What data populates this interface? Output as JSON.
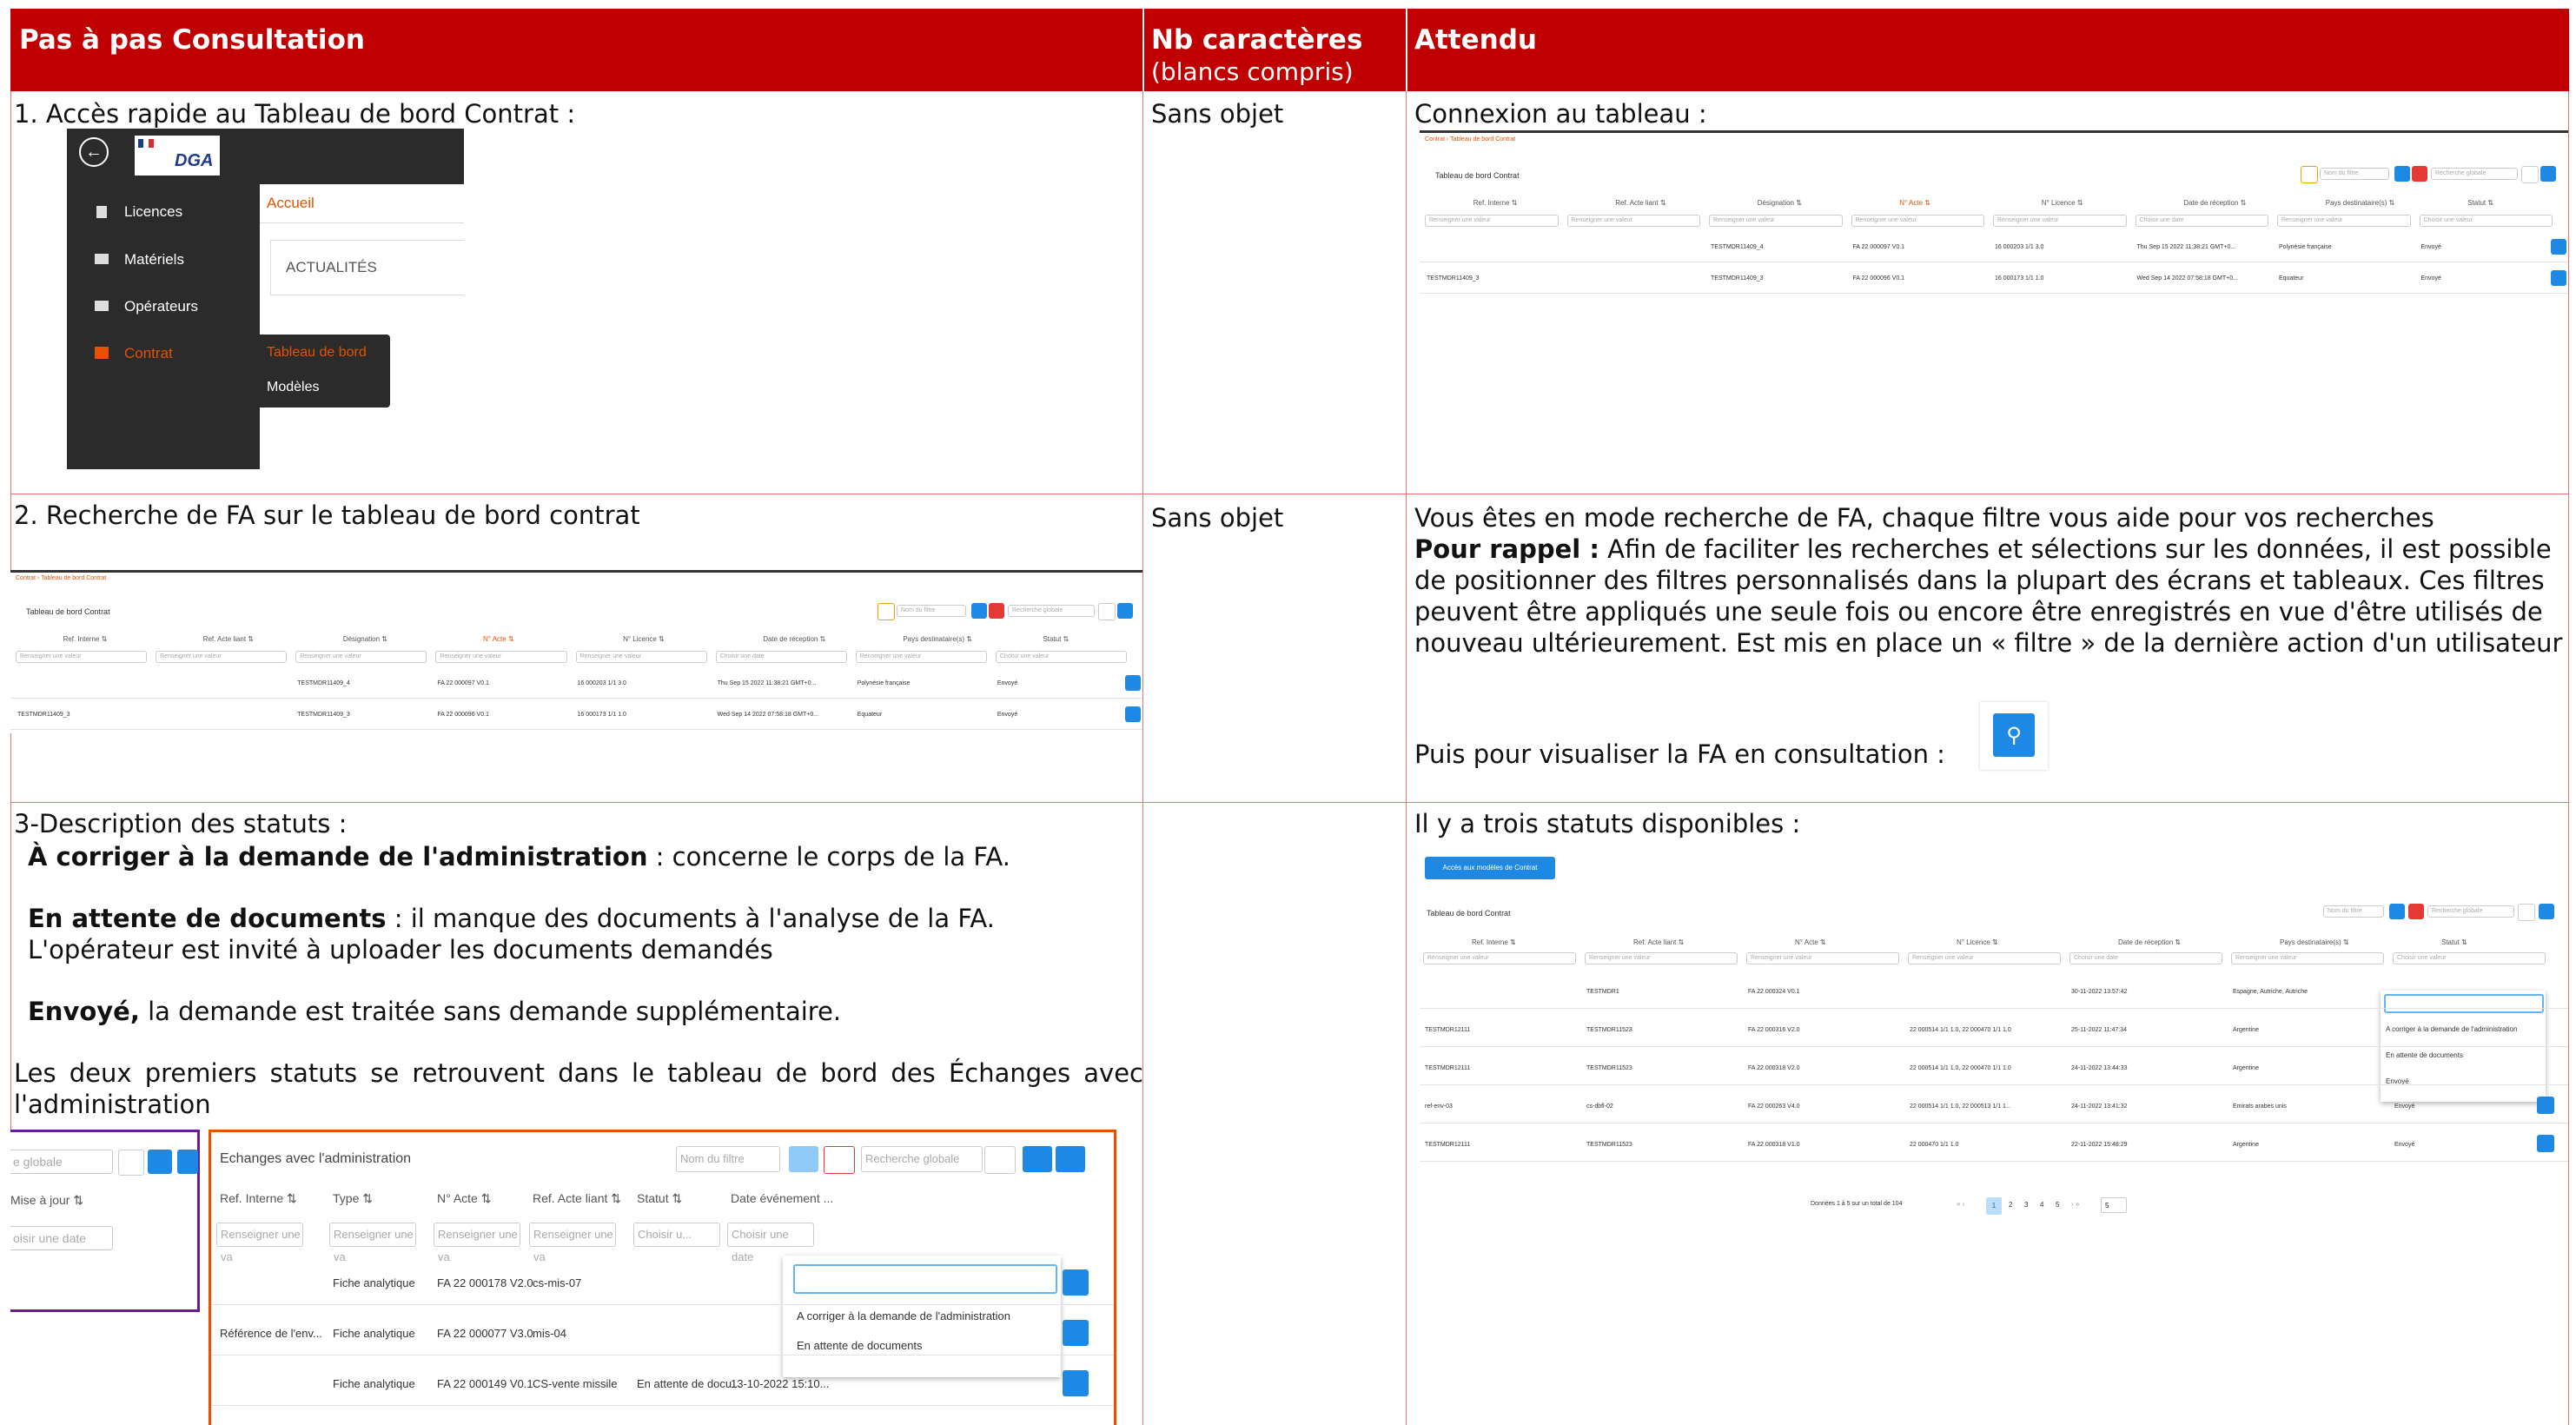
{
  "table": {
    "headers": {
      "col1": "Pas à pas Consultation",
      "col2_title": "Nb caractères",
      "col2_sub": "(blancs compris)",
      "col3": "Attendu"
    },
    "colors": {
      "header_bg": "#c00000",
      "grid": "#e57373",
      "accent": "#1e88e5"
    }
  },
  "row1": {
    "step": "1.   Accès rapide au Tableau de bord Contrat :",
    "chars": "Sans objet",
    "expected": "Connexion au tableau :",
    "nav": {
      "brand": "DGA",
      "items": [
        "Licences",
        "Matériels",
        "Opérateurs",
        "Contrat"
      ],
      "accueil": "Accueil",
      "actualites": "ACTUALITÉS",
      "submenu": [
        "Tableau de bord",
        "Modèles"
      ]
    }
  },
  "row2": {
    "step": "2. Recherche de FA sur le tableau de bord contrat",
    "chars": "Sans objet",
    "line1": "Vous êtes en mode recherche de FA, chaque filtre vous aide pour vos recherches",
    "rappel_label": "Pour rappel :",
    "rappel_text": " Afin de faciliter les recherches et sélections sur les données, il est possible de positionner des filtres personnalisés dans la plupart des écrans et tableaux. Ces filtres peuvent être appliqués une seule fois ou encore être enregistrés en vue d'être utilisés de nouveau ultérieurement. Est mis en place un « filtre » de la dernière action d'un utilisateur",
    "puis": "Puis pour visualiser la FA en consultation :"
  },
  "row3": {
    "title": "3-Description des statuts :",
    "s1_label": "À corriger à la demande de l'administration",
    "s1_text": " : concerne le corps de la FA.",
    "s2_label": "En attente de documents",
    "s2_text": " : il manque des documents à l'analyse de la FA. L'opérateur est invité à uploader les documents demandés",
    "s3_label": "Envoyé,",
    "s3_text": " la demande est traitée sans demande supplémentaire.",
    "note": "Les deux premiers statuts se retrouvent dans le tableau de bord des Échanges avec l'administration",
    "expected": "Il y a trois statuts disponibles :",
    "echanges": {
      "title": "Echanges avec l'administration",
      "headers": [
        "Ref. Interne",
        "Type",
        "N° Acte",
        "Ref. Acte liant",
        "Statut",
        "Date événement ..."
      ],
      "placeholder": "Renseigner une va",
      "statut_select": "Choisir u...",
      "date_placeholder": "Choisir une date",
      "rows": [
        {
          "ref": "",
          "type": "Fiche analytique",
          "acte": "FA 22 000178 V2.0",
          "liant": "cs-mis-07",
          "statut": "",
          "date": ""
        },
        {
          "ref": "Référence de l'env...",
          "type": "Fiche analytique",
          "acte": "FA 22 000077 V3.0",
          "liant": "mis-04",
          "statut": "",
          "date": ""
        },
        {
          "ref": "",
          "type": "Fiche analytique",
          "acte": "FA 22 000149 V0.1",
          "liant": "CS-vente missile",
          "statut": "En attente de docu...",
          "date": "13-10-2022 15:10..."
        }
      ],
      "dropdown": [
        "A corriger à la demande de l'administration",
        "En attente de documents"
      ],
      "left_fragment": {
        "search": "e globale",
        "col": "Mise à jour",
        "date": "oisir une date"
      }
    }
  },
  "mini_dash": {
    "breadcrumb": [
      "Contrat",
      "Tableau de bord Contrat"
    ],
    "title": "Tableau de bord Contrat",
    "filter_name": "Nom du filtre",
    "global_search": "Recherche globale",
    "headers": [
      "Ref. Interne",
      "Ref. Acte liant",
      "Désignation",
      "N° Acte",
      "N° Licence",
      "Date de réception",
      "Pays destinataire(s)",
      "Statut"
    ],
    "placeholder": "Renseigner une valeur",
    "date_placeholder": "Choisir une date",
    "statut_placeholder": "Choisir une valeur",
    "rows": [
      [
        "",
        "",
        "TESTMDR11409_4",
        "FA 22 000097 V0.1",
        "16 000203 1/1 3.0",
        "Thu Sep 15 2022 11:38:21 GMT+0...",
        "Polynésie française",
        "Envoyé"
      ],
      [
        "TESTMDR11409_3",
        "",
        "TESTMDR11409_3",
        "FA 22 000096 V0.1",
        "16 000173 1/1 1.0",
        "Wed Sep 14 2022 07:58:18 GMT+0...",
        "Equateur",
        "Envoyé"
      ]
    ]
  },
  "statuts_dash": {
    "access_btn": "Accès aux modèles de Contrat",
    "title": "Tableau de bord Contrat",
    "filter_name": "Nom du filtre",
    "global_search": "Recherche globale",
    "headers": [
      "Ref. Interne",
      "Ref. Acte liant",
      "N° Acte",
      "N° Licence",
      "Date de réception",
      "Pays destinataire(s)",
      "Statut"
    ],
    "placeholder": "Renseigner une valeur",
    "date_placeholder": "Choisir une date",
    "statut_placeholder": "Choisir une valeur",
    "rows": [
      [
        "",
        "TESTMDR1",
        "FA 22 000324 V0.1",
        "",
        "30-11-2022 13:57:42",
        "Espagne, Autriche, Autriche",
        ""
      ],
      [
        "TESTMDR12111",
        "TESTMDR11523",
        "FA 22 000316 V2.0",
        "22 000514 1/1 1.0, 22 000470 1/1 1.0",
        "25-11-2022 11:47:34",
        "Argentine",
        ""
      ],
      [
        "TESTMDR12111",
        "TESTMDR11523",
        "FA 22 000318 V2.0",
        "22 000514 1/1 1.0, 22 000470 1/1 1.0",
        "24-11-2022 13:44:33",
        "Argentine",
        ""
      ],
      [
        "ref-env-03",
        "cs-dbfl-02",
        "FA 22 000263 V4.0",
        "22 000514 1/1 1.0, 22 000513 1/1 1...",
        "24-11-2022 13:41:32",
        "Emirats arabes unis",
        "Envoyé"
      ],
      [
        "TESTMDR12111",
        "TESTMDR11523",
        "FA 22 000318 V1.0",
        "22 000470 1/1 1.0",
        "22-11-2022 15:48:29",
        "Argentine",
        "Envoyé"
      ]
    ],
    "dropdown": [
      "A corriger à la demande de l'administration",
      "En attente de documents",
      "Envoyé"
    ],
    "pagination": {
      "info": "Données 1 à 5 sur un total de 104",
      "pages": [
        "1",
        "2",
        "3",
        "4",
        "5"
      ],
      "size": "5"
    }
  }
}
